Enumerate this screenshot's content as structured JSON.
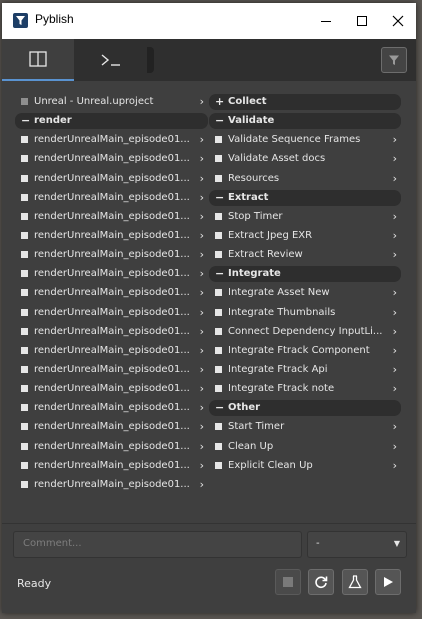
{
  "window": {
    "title": "Pyblish"
  },
  "instances": [
    {
      "label": "Unreal - Unreal.uproject",
      "type": "item",
      "marker": "grey"
    },
    {
      "label": "render",
      "type": "section",
      "sign": "−"
    },
    {
      "label": "renderUnrealMain_episode01...",
      "type": "item"
    },
    {
      "label": "renderUnrealMain_episode01...",
      "type": "item"
    },
    {
      "label": "renderUnrealMain_episode01...",
      "type": "item"
    },
    {
      "label": "renderUnrealMain_episode01...",
      "type": "item"
    },
    {
      "label": "renderUnrealMain_episode01...",
      "type": "item"
    },
    {
      "label": "renderUnrealMain_episode01...",
      "type": "item"
    },
    {
      "label": "renderUnrealMain_episode01...",
      "type": "item"
    },
    {
      "label": "renderUnrealMain_episode01...",
      "type": "item"
    },
    {
      "label": "renderUnrealMain_episode01...",
      "type": "item"
    },
    {
      "label": "renderUnrealMain_episode01...",
      "type": "item"
    },
    {
      "label": "renderUnrealMain_episode01...",
      "type": "item"
    },
    {
      "label": "renderUnrealMain_episode01...",
      "type": "item"
    },
    {
      "label": "renderUnrealMain_episode01...",
      "type": "item"
    },
    {
      "label": "renderUnrealMain_episode01...",
      "type": "item"
    },
    {
      "label": "renderUnrealMain_episode01...",
      "type": "item"
    },
    {
      "label": "renderUnrealMain_episode01...",
      "type": "item"
    },
    {
      "label": "renderUnrealMain_episode01...",
      "type": "item"
    },
    {
      "label": "renderUnrealMain_episode01...",
      "type": "item"
    },
    {
      "label": "renderUnrealMain_episode01...",
      "type": "item"
    }
  ],
  "plugins": [
    {
      "label": "Collect",
      "type": "section",
      "sign": "+"
    },
    {
      "label": "Validate",
      "type": "section",
      "sign": "−"
    },
    {
      "label": "Validate Sequence Frames",
      "type": "item"
    },
    {
      "label": "Validate Asset docs",
      "type": "item"
    },
    {
      "label": "Resources",
      "type": "item"
    },
    {
      "label": "Extract",
      "type": "section",
      "sign": "−"
    },
    {
      "label": "Stop Timer",
      "type": "item"
    },
    {
      "label": "Extract Jpeg EXR",
      "type": "item"
    },
    {
      "label": "Extract Review",
      "type": "item"
    },
    {
      "label": "Integrate",
      "type": "section",
      "sign": "−"
    },
    {
      "label": "Integrate Asset New",
      "type": "item"
    },
    {
      "label": "Integrate Thumbnails",
      "type": "item"
    },
    {
      "label": "Connect Dependency InputLi...",
      "type": "item"
    },
    {
      "label": "Integrate Ftrack Component",
      "type": "item"
    },
    {
      "label": "Integrate Ftrack Api",
      "type": "item"
    },
    {
      "label": "Integrate Ftrack note",
      "type": "item"
    },
    {
      "label": "Other",
      "type": "section",
      "sign": "−"
    },
    {
      "label": "Start Timer",
      "type": "item"
    },
    {
      "label": "Clean Up",
      "type": "item"
    },
    {
      "label": "Explicit Clean Up",
      "type": "item"
    }
  ],
  "footer": {
    "comment_placeholder": "Comment...",
    "dropdown_value": "-",
    "status": "Ready"
  },
  "colors": {
    "accent": "#5a93d1",
    "background": "#3f3f3f"
  },
  "icons": {
    "app": "pyblish-funnel-icon",
    "tab1": "split-view-icon",
    "tab2": "terminal-icon",
    "filter": "funnel-icon",
    "stop": "stop-icon",
    "reset": "refresh-icon",
    "validate": "flask-icon",
    "publish": "play-icon"
  }
}
